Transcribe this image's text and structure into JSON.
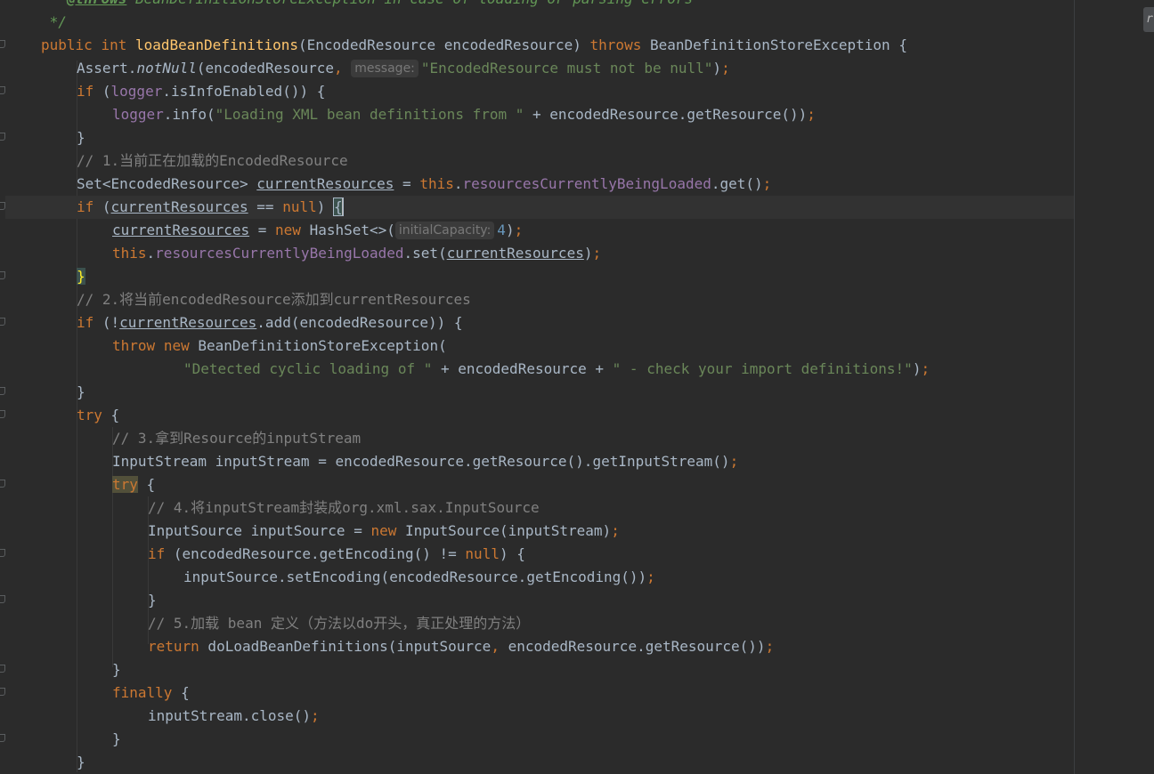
{
  "editor": {
    "lines": {
      "l0": {
        "star": " * ",
        "tag": "@throws",
        "exc": " BeanDefinitionStoreException",
        "rest": " in case of loading or parsing errors"
      },
      "l1": {
        "close": " */"
      },
      "l2": {
        "kw_public": "public",
        "kw_int": "int",
        "fn": "loadBeanDefinitions",
        "p1": "(EncodedResource encodedResource) ",
        "kw_throws": "throws",
        "p2": " BeanDefinitionStoreException {"
      },
      "l3": {
        "a": "Assert.",
        "fn": "notNull",
        "b": "(encodedResource",
        "comma": ", ",
        "hint": "message:",
        "str": "\"EncodedResource must not be null\"",
        "c": ")",
        "semi": ";"
      },
      "l4": {
        "kw": "if",
        "a": " (",
        "field": "logger",
        "b": ".isInfoEnabled()) {"
      },
      "l5": {
        "field": "logger",
        "a": ".info(",
        "str": "\"Loading XML bean definitions from \"",
        "b": " + encodedResource.getResource())",
        "semi": ";"
      },
      "l6": {
        "a": "}"
      },
      "l7": {
        "cmt": "// 1.当前正在加载的EncodedResource"
      },
      "l8": {
        "a": "Set<EncodedResource> ",
        "var": "currentResources",
        "b": " = ",
        "kw": "this",
        "dot": ".",
        "field": "resourcesCurrentlyBeingLoaded",
        "c": ".get()",
        "semi": ";"
      },
      "l9": {
        "kw": "if",
        "a": " (",
        "var": "currentResources",
        "b": " == ",
        "kw2": "null",
        "c": ") ",
        "brace": "{"
      },
      "l10": {
        "var": "currentResources",
        "a": " = ",
        "kw": "new",
        "b": " HashSet<>(",
        "hint": "initialCapacity:",
        "num": "4",
        "c": ")",
        "semi": ";"
      },
      "l11": {
        "kw": "this",
        "dot": ".",
        "field": "resourcesCurrentlyBeingLoaded",
        "a": ".set(",
        "var": "currentResources",
        "b": ")",
        "semi": ";"
      },
      "l12": {
        "brace": "}"
      },
      "l13": {
        "cmt": "// 2.将当前encodedResource添加到currentResources"
      },
      "l14": {
        "kw": "if",
        "a": " (!",
        "var": "currentResources",
        "b": ".add(encodedResource)) {"
      },
      "l15": {
        "kw": "throw",
        "kw2": "new",
        "a": " BeanDefinitionStoreException("
      },
      "l16": {
        "str1": "\"Detected cyclic loading of \"",
        "a": " + encodedResource + ",
        "str2": "\" - check your import definitions!\"",
        "b": ")",
        "semi": ";"
      },
      "l17": {
        "a": "}"
      },
      "l18": {
        "kw": "try",
        "a": " {"
      },
      "l19": {
        "cmt": "// 3.拿到Resource的inputStream"
      },
      "l20": {
        "a": "InputStream inputStream = encodedResource.getResource().getInputStream()",
        "semi": ";"
      },
      "l21": {
        "kw": "try",
        "a": " {"
      },
      "l22": {
        "cmt": "// 4.将inputStream封装成org.xml.sax.InputSource"
      },
      "l23": {
        "a": "InputSource inputSource = ",
        "kw": "new",
        "b": " InputSource(inputStream)",
        "semi": ";"
      },
      "l24": {
        "kw": "if",
        "a": " (encodedResource.getEncoding() != ",
        "kw2": "null",
        "b": ") {"
      },
      "l25": {
        "a": "inputSource.setEncoding(encodedResource.getEncoding())",
        "semi": ";"
      },
      "l26": {
        "a": "}"
      },
      "l27": {
        "cmt": "// 5.加载 bean 定义（方法以do开头，真正处理的方法）"
      },
      "l28": {
        "kw": "return",
        "a": " doLoadBeanDefinitions(inputSource",
        "comma": ", ",
        "b": "encodedResource.getResource())",
        "semi": ";"
      },
      "l29": {
        "a": "}"
      },
      "l30": {
        "kw": "finally",
        "a": " {"
      },
      "l31": {
        "a": "inputStream.close()",
        "semi": ";"
      },
      "l32": {
        "a": "}"
      },
      "l33": {
        "a": "}"
      }
    }
  },
  "scroll_tab": {
    "label": "r"
  },
  "colors": {
    "background": "#2b2b2b",
    "keyword": "#cc7832",
    "string": "#6a8759",
    "number": "#6897bb",
    "method_decl": "#ffc66d",
    "field": "#9876aa",
    "comment": "#808080",
    "default_text": "#a9b7c6"
  }
}
